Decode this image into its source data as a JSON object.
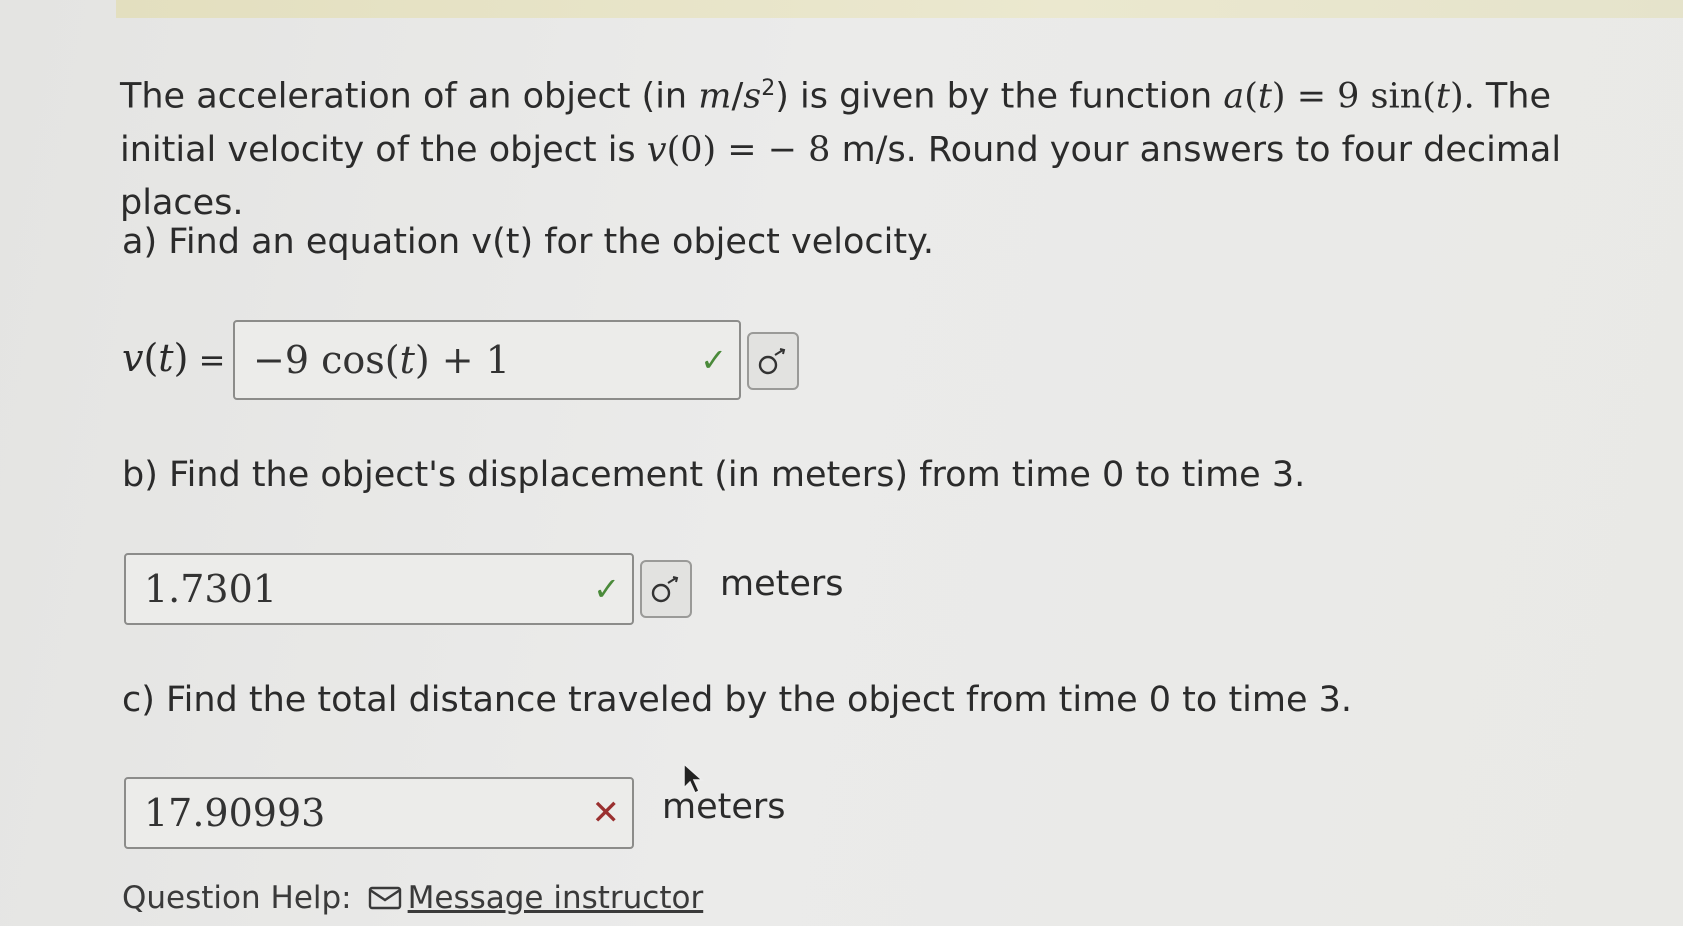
{
  "problem": {
    "text1": "The acceleration of an object (in ",
    "unit_m": "m",
    "unit_s": "s",
    "unit_exp": "2",
    "text2": ") is given by the function ",
    "func_a": "a",
    "func_t": "t",
    "func_eq": "= 9 sin(",
    "func_t2": "t",
    "func_close": ").",
    "text3": " The initial velocity of the object is ",
    "v0_v": "v",
    "v0_rest": "(0) = − 8",
    "text4": " m/s. Round your answers to four decimal places."
  },
  "part_a": {
    "question": "a) Find an equation v(t) for the object velocity.",
    "label_v": "v",
    "label_t": "t",
    "label_eq": " =",
    "answer": "−9 cos(t) + 1",
    "answer_pre": "−9 cos(",
    "answer_t": "t",
    "answer_post": ") + 1",
    "status": "correct"
  },
  "part_b": {
    "question": "b) Find the object's displacement (in meters) from time 0 to time 3.",
    "answer": "1.7301",
    "unit": "meters",
    "status": "correct"
  },
  "part_c": {
    "question": "c) Find the total distance traveled by the object from time 0 to time 3.",
    "answer": "17.90993",
    "unit": "meters",
    "status": "incorrect"
  },
  "help": {
    "label": "Question Help:",
    "link": "Message instructor"
  },
  "icons": {
    "correct": "check-icon",
    "incorrect": "x-icon",
    "preview": "preview-icon",
    "message": "envelope-icon"
  },
  "colors": {
    "correct": "#4a8a3a",
    "incorrect": "#9a3030"
  }
}
